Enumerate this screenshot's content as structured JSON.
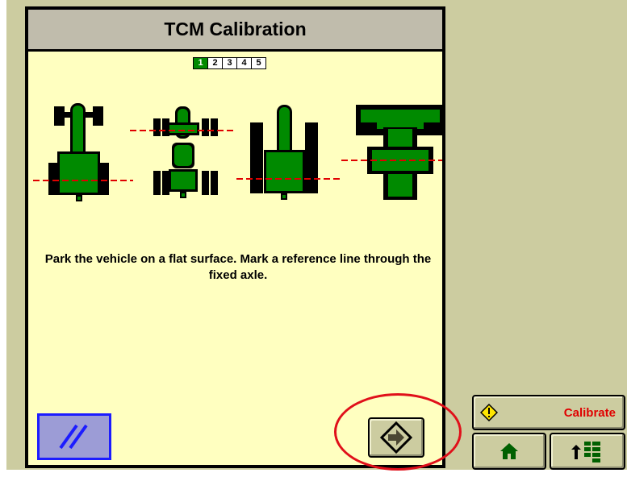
{
  "dialog": {
    "title": "TCM Calibration",
    "steps": [
      "1",
      "2",
      "3",
      "4",
      "5"
    ],
    "active_step": "1",
    "instructions": "Park the vehicle on a flat surface.  Mark a reference line through the fixed axle."
  },
  "diagrams": [
    {
      "name": "tractor-mfwd-diagram"
    },
    {
      "name": "tractor-4wd-diagram"
    },
    {
      "name": "tractor-2wd-diagram"
    },
    {
      "name": "track-tractor-diagram"
    }
  ],
  "buttons": {
    "cancel_icon": "cancel-slash-icon",
    "next_icon": "next-arrow-icon",
    "calibrate_label": "Calibrate",
    "calibrate_icon": "warning-icon",
    "home_icon": "home-icon",
    "menu_icon": "menu-up-icon"
  },
  "colors": {
    "panel_bg": "#cccca0",
    "dialog_bg": "#ffffc0",
    "title_bg": "#c0bcac",
    "vehicle_green": "#008a00",
    "reference_line": "#e00000",
    "cancel_bg": "#9c9cd6",
    "cancel_border": "#1c1cff",
    "highlight": "#e0101a"
  }
}
